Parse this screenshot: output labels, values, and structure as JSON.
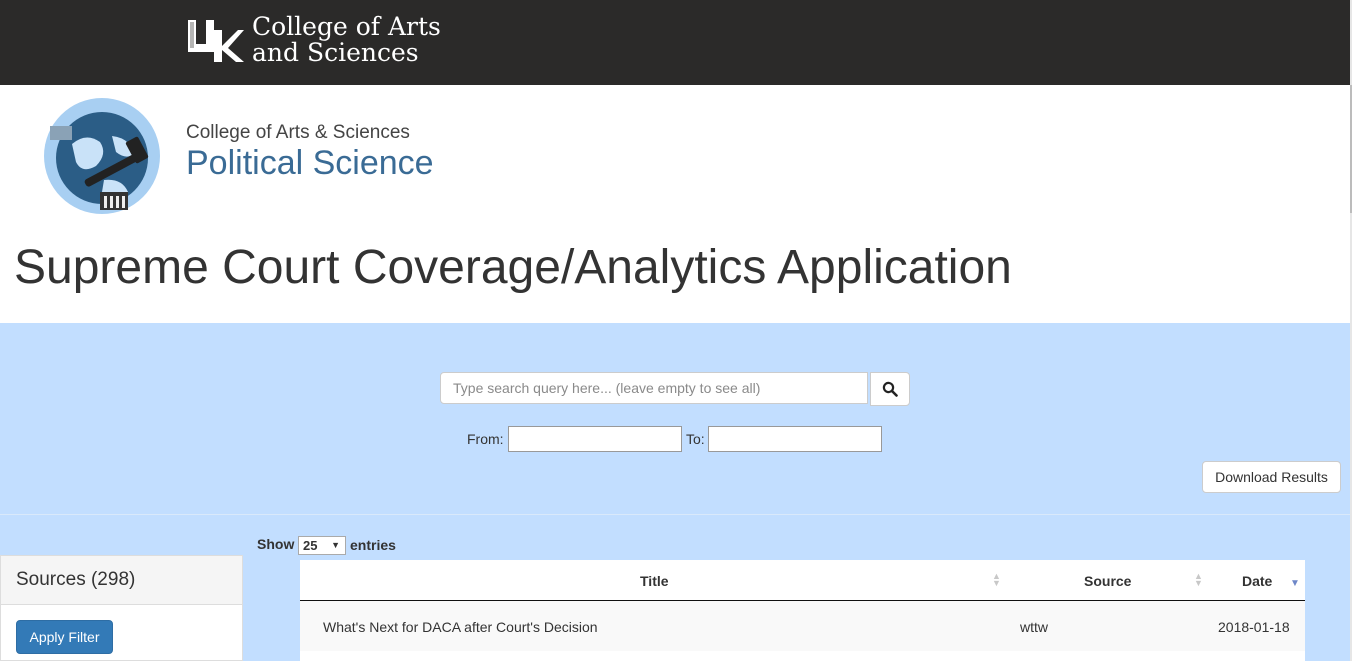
{
  "uk_header": {
    "logo_text": "UK",
    "college_line1": "College of Arts",
    "college_line2": "and Sciences"
  },
  "dept": {
    "college": "College of Arts & Sciences",
    "name": "Political Science"
  },
  "page_title": "Supreme Court Coverage/Analytics Application",
  "search": {
    "placeholder": "Type search query here... (leave empty to see all)",
    "value": ""
  },
  "date_filter": {
    "from_label": "From:",
    "to_label": "To:",
    "from_value": "",
    "to_value": ""
  },
  "download_label": "Download Results",
  "entries": {
    "show_label": "Show",
    "value": "25",
    "suffix": "entries"
  },
  "sources": {
    "title": "Sources (298)",
    "apply_label": "Apply Filter"
  },
  "table": {
    "columns": [
      "Title",
      "Source",
      "Date"
    ],
    "rows": [
      {
        "title": "What's Next for DACA after Court's Decision",
        "source": "wttw",
        "date": "2018-01-18"
      }
    ]
  },
  "colors": {
    "topbar": "#2b2a29",
    "dept_blue": "#3a6b95",
    "panel_bg": "#c2deff",
    "primary": "#337ab7"
  }
}
